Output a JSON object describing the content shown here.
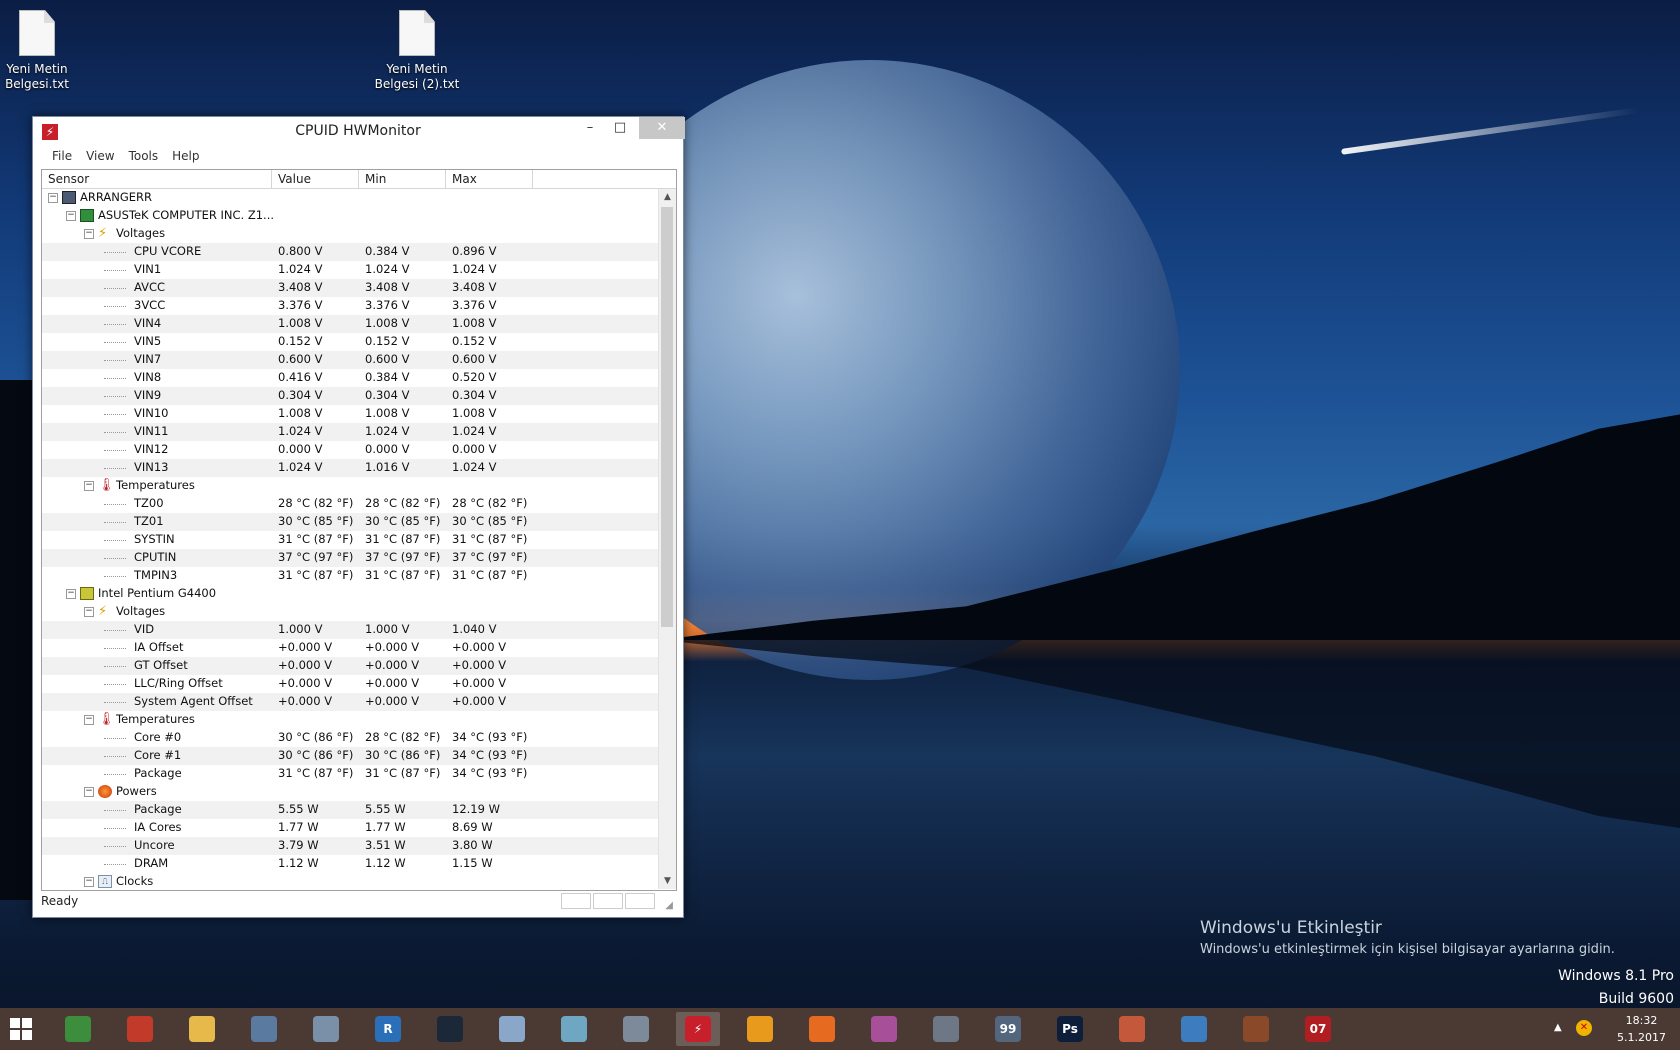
{
  "desktop": {
    "icons": [
      {
        "label_line1": "Yeni Metin",
        "label_line2": "Belgesi.txt"
      },
      {
        "label_line1": "Yeni Metin",
        "label_line2": "Belgesi (2).txt"
      }
    ],
    "activation": {
      "title": "Windows'u Etkinleştir",
      "subtitle": "Windows'u etkinleştirmek için kişisel bilgisayar ayarlarına gidin."
    },
    "version": {
      "line1": "Windows 8.1 Pro",
      "line2": "Build 9600"
    }
  },
  "window": {
    "title": "CPUID HWMonitor",
    "controls": {
      "minimize": "–",
      "maximize": "□",
      "close": "✕"
    },
    "menu": [
      "File",
      "View",
      "Tools",
      "Help"
    ],
    "columns": [
      "Sensor",
      "Value",
      "Min",
      "Max"
    ],
    "status": "Ready",
    "rows": [
      {
        "level": 0,
        "type": "pc",
        "name": "ARRANGERR"
      },
      {
        "level": 1,
        "type": "mb",
        "name": "ASUSTeK COMPUTER INC. Z1..."
      },
      {
        "level": 2,
        "type": "volt",
        "name": "Voltages"
      },
      {
        "level": 3,
        "name": "CPU VCORE",
        "value": "0.800 V",
        "min": "0.384 V",
        "max": "0.896 V"
      },
      {
        "level": 3,
        "name": "VIN1",
        "value": "1.024 V",
        "min": "1.024 V",
        "max": "1.024 V"
      },
      {
        "level": 3,
        "name": "AVCC",
        "value": "3.408 V",
        "min": "3.408 V",
        "max": "3.408 V"
      },
      {
        "level": 3,
        "name": "3VCC",
        "value": "3.376 V",
        "min": "3.376 V",
        "max": "3.376 V"
      },
      {
        "level": 3,
        "name": "VIN4",
        "value": "1.008 V",
        "min": "1.008 V",
        "max": "1.008 V"
      },
      {
        "level": 3,
        "name": "VIN5",
        "value": "0.152 V",
        "min": "0.152 V",
        "max": "0.152 V"
      },
      {
        "level": 3,
        "name": "VIN7",
        "value": "0.600 V",
        "min": "0.600 V",
        "max": "0.600 V"
      },
      {
        "level": 3,
        "name": "VIN8",
        "value": "0.416 V",
        "min": "0.384 V",
        "max": "0.520 V"
      },
      {
        "level": 3,
        "name": "VIN9",
        "value": "0.304 V",
        "min": "0.304 V",
        "max": "0.304 V"
      },
      {
        "level": 3,
        "name": "VIN10",
        "value": "1.008 V",
        "min": "1.008 V",
        "max": "1.008 V"
      },
      {
        "level": 3,
        "name": "VIN11",
        "value": "1.024 V",
        "min": "1.024 V",
        "max": "1.024 V"
      },
      {
        "level": 3,
        "name": "VIN12",
        "value": "0.000 V",
        "min": "0.000 V",
        "max": "0.000 V"
      },
      {
        "level": 3,
        "name": "VIN13",
        "value": "1.024 V",
        "min": "1.016 V",
        "max": "1.024 V"
      },
      {
        "level": 2,
        "type": "temp",
        "name": "Temperatures"
      },
      {
        "level": 3,
        "name": "TZ00",
        "value": "28 °C  (82 °F)",
        "min": "28 °C  (82 °F)",
        "max": "28 °C  (82 °F)"
      },
      {
        "level": 3,
        "name": "TZ01",
        "value": "30 °C  (85 °F)",
        "min": "30 °C  (85 °F)",
        "max": "30 °C  (85 °F)"
      },
      {
        "level": 3,
        "name": "SYSTIN",
        "value": "31 °C  (87 °F)",
        "min": "31 °C  (87 °F)",
        "max": "31 °C  (87 °F)"
      },
      {
        "level": 3,
        "name": "CPUTIN",
        "value": "37 °C  (97 °F)",
        "min": "37 °C  (97 °F)",
        "max": "37 °C  (97 °F)"
      },
      {
        "level": 3,
        "name": "TMPIN3",
        "value": "31 °C  (87 °F)",
        "min": "31 °C  (87 °F)",
        "max": "31 °C  (87 °F)"
      },
      {
        "level": 1,
        "type": "cpu",
        "name": "Intel Pentium G4400"
      },
      {
        "level": 2,
        "type": "volt",
        "name": "Voltages"
      },
      {
        "level": 3,
        "name": "VID",
        "value": "1.000 V",
        "min": "1.000 V",
        "max": "1.040 V"
      },
      {
        "level": 3,
        "name": "IA Offset",
        "value": "+0.000 V",
        "min": "+0.000 V",
        "max": "+0.000 V"
      },
      {
        "level": 3,
        "name": "GT Offset",
        "value": "+0.000 V",
        "min": "+0.000 V",
        "max": "+0.000 V"
      },
      {
        "level": 3,
        "name": "LLC/Ring Offset",
        "value": "+0.000 V",
        "min": "+0.000 V",
        "max": "+0.000 V"
      },
      {
        "level": 3,
        "name": "System Agent Offset",
        "value": "+0.000 V",
        "min": "+0.000 V",
        "max": "+0.000 V"
      },
      {
        "level": 2,
        "type": "temp",
        "name": "Temperatures"
      },
      {
        "level": 3,
        "name": "Core #0",
        "value": "30 °C  (86 °F)",
        "min": "28 °C  (82 °F)",
        "max": "34 °C  (93 °F)"
      },
      {
        "level": 3,
        "name": "Core #1",
        "value": "30 °C  (86 °F)",
        "min": "30 °C  (86 °F)",
        "max": "34 °C  (93 °F)"
      },
      {
        "level": 3,
        "name": "Package",
        "value": "31 °C  (87 °F)",
        "min": "31 °C  (87 °F)",
        "max": "34 °C  (93 °F)"
      },
      {
        "level": 2,
        "type": "pow",
        "name": "Powers"
      },
      {
        "level": 3,
        "name": "Package",
        "value": "5.55 W",
        "min": "5.55 W",
        "max": "12.19 W"
      },
      {
        "level": 3,
        "name": "IA Cores",
        "value": "1.77 W",
        "min": "1.77 W",
        "max": "8.69 W"
      },
      {
        "level": 3,
        "name": "Uncore",
        "value": "3.79 W",
        "min": "3.51 W",
        "max": "3.80 W"
      },
      {
        "level": 3,
        "name": "DRAM",
        "value": "1.12 W",
        "min": "1.12 W",
        "max": "1.15 W"
      },
      {
        "level": 2,
        "type": "clk",
        "name": "Clocks"
      }
    ]
  },
  "taskbar": {
    "apps": [
      {
        "name": "chrome-icon",
        "color": "#3c8d3c",
        "glyph": ""
      },
      {
        "name": "ccleaner-icon",
        "color": "#c23a2a",
        "glyph": ""
      },
      {
        "name": "file-explorer-icon",
        "color": "#e7b84a",
        "glyph": ""
      },
      {
        "name": "keyboard-icon",
        "color": "#5a7aa0",
        "glyph": ""
      },
      {
        "name": "monitor-app-icon",
        "color": "#7a8fa8",
        "glyph": ""
      },
      {
        "name": "r-app-icon",
        "color": "#2a6fb8",
        "glyph": "R"
      },
      {
        "name": "steam-icon",
        "color": "#1b2838",
        "glyph": ""
      },
      {
        "name": "paint-icon",
        "color": "#8aa6c8",
        "glyph": ""
      },
      {
        "name": "notepad-icon",
        "color": "#6fa7c2",
        "glyph": ""
      },
      {
        "name": "calculator-icon",
        "color": "#7c8a99",
        "glyph": ""
      },
      {
        "name": "hwmonitor-icon",
        "color": "#c8202a",
        "glyph": "⚡",
        "active": true
      },
      {
        "name": "link-app-icon",
        "color": "#e79a1c",
        "glyph": ""
      },
      {
        "name": "firefox-icon",
        "color": "#e66a1f",
        "glyph": ""
      },
      {
        "name": "cocktail-icon",
        "color": "#a84f9a",
        "glyph": ""
      },
      {
        "name": "camera-icon",
        "color": "#6d7785",
        "glyph": ""
      },
      {
        "name": "display-app-icon",
        "color": "#54667e",
        "glyph": "99"
      },
      {
        "name": "photoshop-icon",
        "color": "#0d1e3a",
        "glyph": "Ps"
      },
      {
        "name": "tool-app-icon",
        "color": "#c4583a",
        "glyph": ""
      },
      {
        "name": "water-drop-icon",
        "color": "#3e7cc0",
        "glyph": ""
      },
      {
        "name": "game-character-icon",
        "color": "#8a4a2a",
        "glyph": ""
      },
      {
        "name": "number-app-icon",
        "color": "#b11e22",
        "glyph": "07"
      }
    ],
    "tray": {
      "arrow": "▲",
      "time": "18:32",
      "date": "5.1.2017"
    }
  }
}
